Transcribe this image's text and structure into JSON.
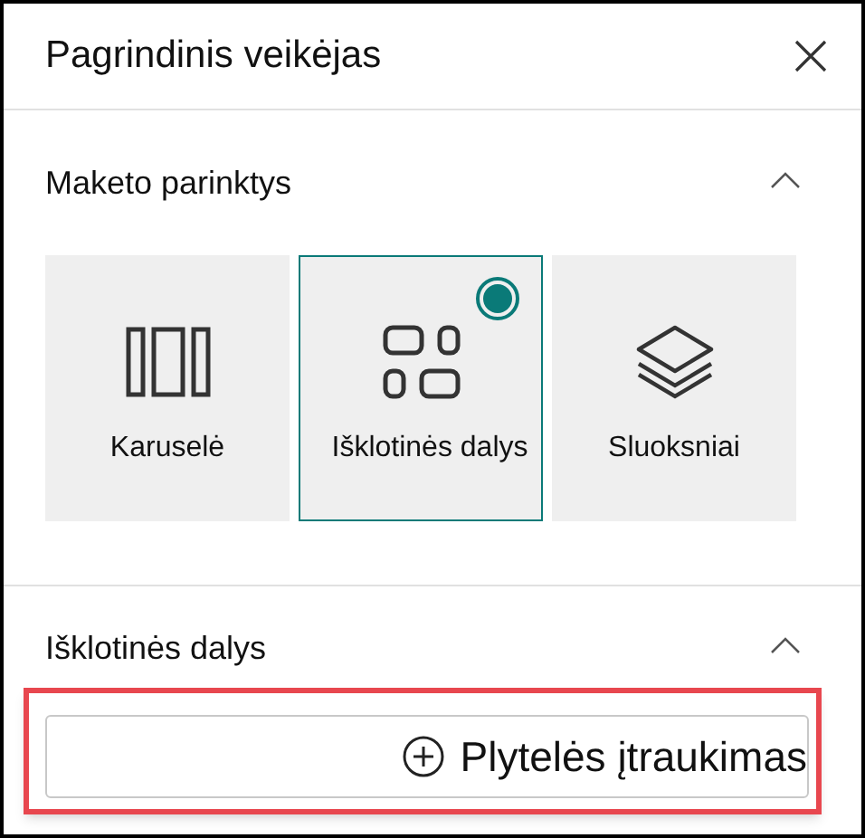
{
  "panel": {
    "title": "Pagrindinis veikėjas"
  },
  "layout_section": {
    "title": "Maketo parinktys",
    "expanded": true,
    "options": [
      {
        "kind": "carousel",
        "label": "Karuselė",
        "selected": false
      },
      {
        "kind": "tiles",
        "label": "Išklotinės dalys",
        "selected": true
      },
      {
        "kind": "layers",
        "label": "Sluoksniai",
        "selected": false
      }
    ]
  },
  "tiles_section": {
    "title": "Išklotinės dalys",
    "expanded": true,
    "add_button": {
      "label": "Plytelės įtraukimas",
      "highlighted": true
    }
  }
}
